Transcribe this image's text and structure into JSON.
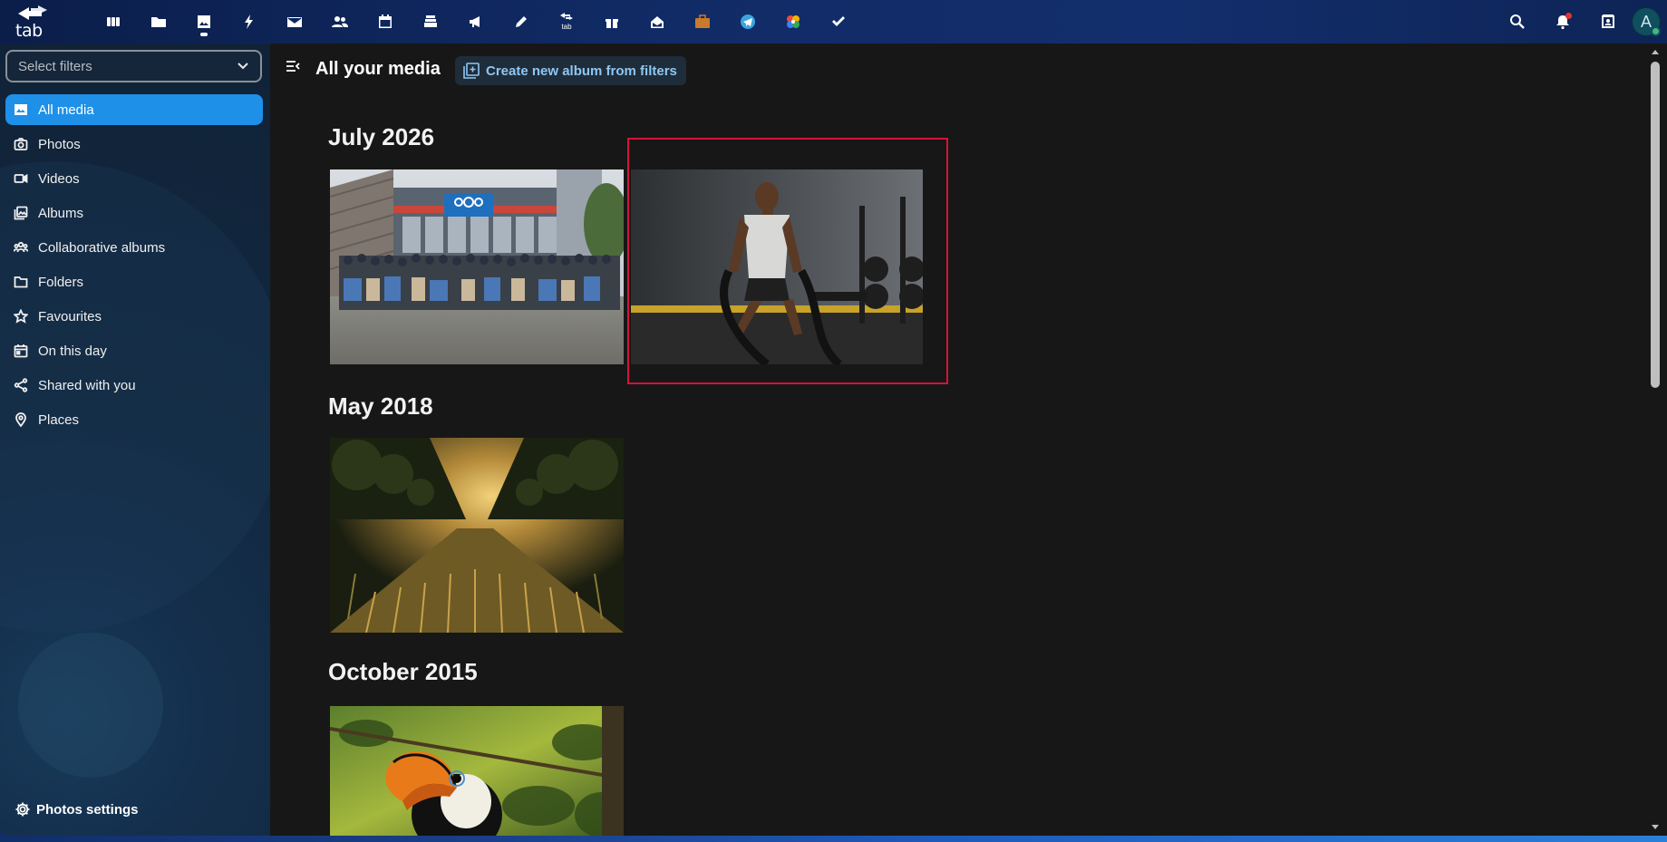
{
  "topbar": {
    "logo_text": "tab",
    "apps": [
      {
        "name": "dashboard-icon"
      },
      {
        "name": "files-icon"
      },
      {
        "name": "photos-icon",
        "active": true
      },
      {
        "name": "activity-icon"
      },
      {
        "name": "mail-icon"
      },
      {
        "name": "contacts-icon"
      },
      {
        "name": "calendar-icon"
      },
      {
        "name": "deck-icon"
      },
      {
        "name": "announcements-icon"
      },
      {
        "name": "notes-icon"
      },
      {
        "name": "tab-app-icon",
        "label": "tab"
      },
      {
        "name": "gift-icon"
      },
      {
        "name": "inbox-icon"
      },
      {
        "name": "briefcase-icon"
      },
      {
        "name": "telegram-icon"
      },
      {
        "name": "pinwheel-icon"
      },
      {
        "name": "tasks-icon"
      }
    ],
    "avatar_letter": "A"
  },
  "sidebar": {
    "filter_placeholder": "Select filters",
    "items": [
      {
        "label": "All media",
        "icon": "image-icon",
        "active": true
      },
      {
        "label": "Photos",
        "icon": "camera-icon"
      },
      {
        "label": "Videos",
        "icon": "video-icon"
      },
      {
        "label": "Albums",
        "icon": "albums-icon"
      },
      {
        "label": "Collaborative albums",
        "icon": "people-icon"
      },
      {
        "label": "Folders",
        "icon": "folder-icon"
      },
      {
        "label": "Favourites",
        "icon": "star-icon"
      },
      {
        "label": "On this day",
        "icon": "calendar-icon"
      },
      {
        "label": "Shared with you",
        "icon": "share-icon"
      },
      {
        "label": "Places",
        "icon": "pin-icon"
      }
    ],
    "settings_label": "Photos settings"
  },
  "main": {
    "title": "All your media",
    "create_album_label": "Create new album from filters",
    "sections": [
      {
        "title": "July 2026"
      },
      {
        "title": "May 2018"
      },
      {
        "title": "October 2015"
      }
    ]
  },
  "colors": {
    "accent": "#1e90e8",
    "highlight": "#d4143a",
    "main_bg": "#171717"
  }
}
